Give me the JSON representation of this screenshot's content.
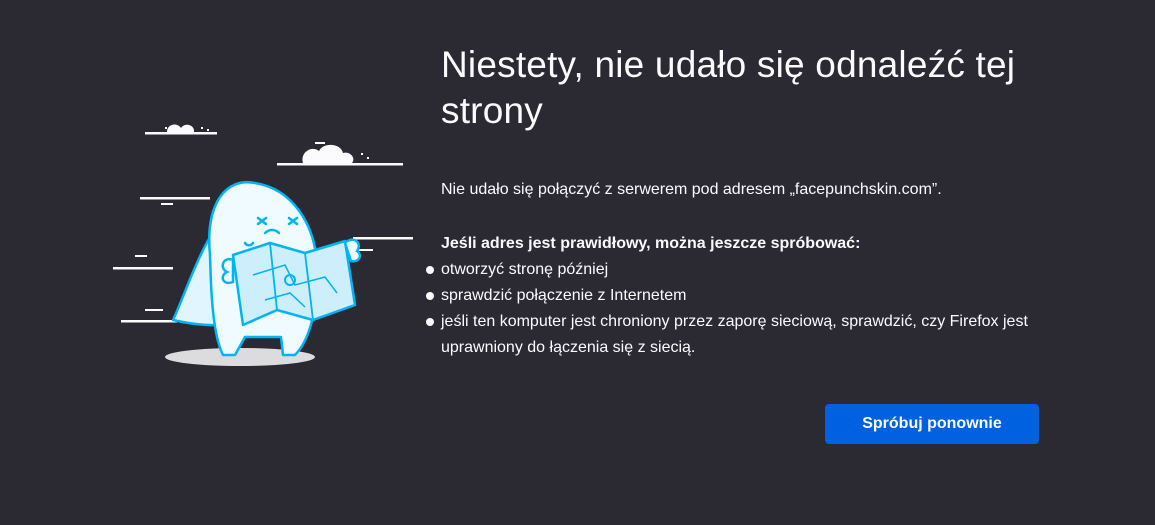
{
  "error_page": {
    "title": "Niestety, nie udało się odnaleźć tej strony",
    "description": "Nie udało się połączyć z serwerem pod adresem „facepunchskin.com”.",
    "suggestions_heading": "Jeśli adres jest prawidłowy, można jeszcze spróbować:",
    "suggestions": [
      "otworzyć stronę później",
      "sprawdzić połączenie z Internetem",
      "jeśli ten komputer jest chroniony przez zaporę sieciową, sprawdzić, czy Firefox jest uprawniony do łączenia się z siecią."
    ],
    "retry_label": "Spróbuj ponownie"
  },
  "illustration": {
    "icon": "lost-character-with-map-illustration"
  },
  "colors": {
    "background": "#2b2a33",
    "text": "#fbfbfe",
    "accent": "#0061e0",
    "illustration_outline": "#00b3f4"
  }
}
